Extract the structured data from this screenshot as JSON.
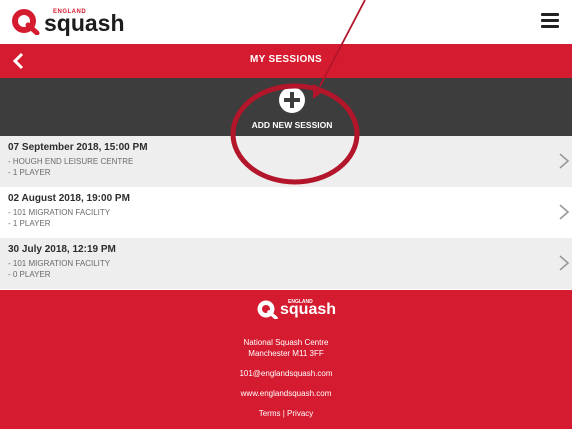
{
  "header": {
    "logo_small": "ENGLAND",
    "logo_big": "squash",
    "menu_icon": "hamburger-menu-icon"
  },
  "titlebar": {
    "back_icon": "chevron-left-icon",
    "title": "MY SESSIONS"
  },
  "add_session": {
    "icon": "plus-circle-icon",
    "label": "ADD NEW SESSION"
  },
  "sessions": [
    {
      "date": "07 September 2018, 15:00 PM",
      "venue": "- HOUGH END LEISURE CENTRE",
      "players": "- 1 PLAYER"
    },
    {
      "date": "02 August 2018, 19:00 PM",
      "venue": "- 101 MIGRATION FACILITY",
      "players": "- 1 PLAYER"
    },
    {
      "date": "30 July 2018, 12:19 PM",
      "venue": "- 101 MIGRATION FACILITY",
      "players": "- 0 PLAYER"
    }
  ],
  "footer": {
    "logo_small": "ENGLAND",
    "logo_big": "squash",
    "address_line1": "National Squash Centre",
    "address_line2": "Manchester M11 3FF",
    "email": "101@englandsquash.com",
    "website": "www.englandsquash.com",
    "terms": "Terms",
    "separator": "|",
    "privacy": "Privacy"
  },
  "colors": {
    "brand_red": "#d51b2f",
    "dark_bar": "#3d3d3d",
    "annotation": "#b3152a"
  }
}
